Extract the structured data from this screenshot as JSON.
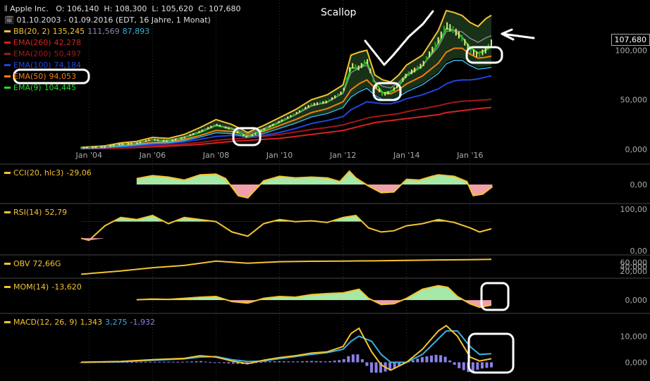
{
  "header": {
    "instrument": "Apple Inc.",
    "open": "O: 106,140",
    "high": "H: 108,300",
    "low": "L: 105,620",
    "close": "C: 107,680",
    "range": "01.10.2003 - 01.09.2016 (EDT, 16 Jahre, 1 Monat)",
    "last_price": "107,680"
  },
  "annotation_title": "Scallop",
  "legend": [
    {
      "label": "BB(20, 2)",
      "value": "135,245",
      "extra1": "111,569",
      "extra2": "87,893",
      "color": "#f4c430"
    },
    {
      "label": "EMA(260)",
      "value": "42,278",
      "color": "#d92020"
    },
    {
      "label": "EMA(200)",
      "value": "50,497",
      "color": "#a01818"
    },
    {
      "label": "EMA(100)",
      "value": "74,184",
      "color": "#2244dd"
    },
    {
      "label": "EMA(50)",
      "value": "94,053",
      "color": "#f08010"
    },
    {
      "label": "EMA(9)",
      "value": "104,445",
      "color": "#22dd22"
    }
  ],
  "panels": {
    "cci": {
      "label": "CCI(20, hlc3)",
      "value": "-29,06"
    },
    "rsi": {
      "label": "RSI(14)",
      "value": "52,79"
    },
    "obv": {
      "label": "OBV",
      "value": "72,66G"
    },
    "mom": {
      "label": "MOM(14)",
      "value": "-13,620"
    },
    "macd": {
      "label": "MACD(12, 26, 9)",
      "value": "1,343",
      "signal": "3,275",
      "hist": "-1,932"
    }
  },
  "chart_data": [
    {
      "type": "line",
      "title": "Apple Inc.",
      "x": [
        2003.75,
        2004.5,
        2005.0,
        2005.5,
        2006.0,
        2006.5,
        2007.0,
        2007.5,
        2008.0,
        2008.5,
        2009.0,
        2009.5,
        2010.0,
        2010.5,
        2011.0,
        2011.5,
        2012.0,
        2012.25,
        2012.5,
        2012.75,
        2013.0,
        2013.25,
        2013.5,
        2013.75,
        2014.0,
        2014.5,
        2015.0,
        2015.25,
        2015.5,
        2015.75,
        2016.0,
        2016.25,
        2016.5,
        2016.67
      ],
      "x_ticks": [
        "Jan '04",
        "Jan '06",
        "Jan '08",
        "Jan '10",
        "Jan '12",
        "Jan '14",
        "Jan '16"
      ],
      "x_tick_values": [
        2004,
        2006,
        2008,
        2010,
        2012,
        2014,
        2016
      ],
      "y_ticks": [
        "0,000",
        "50,000",
        "100,000"
      ],
      "y_tick_values": [
        0,
        50,
        100
      ],
      "ylim": [
        0,
        145
      ],
      "series": [
        {
          "name": "Close",
          "values": [
            1.5,
            2.5,
            5,
            6,
            10,
            8,
            12,
            18,
            25,
            20,
            12,
            20,
            28,
            36,
            45,
            48,
            58,
            85,
            82,
            90,
            65,
            55,
            58,
            65,
            75,
            85,
            110,
            125,
            120,
            112,
            100,
            95,
            100,
            107.68
          ]
        },
        {
          "name": "BB(20, 2)",
          "values": [
            2,
            3.5,
            6.5,
            8,
            12,
            11,
            15,
            22,
            30,
            25,
            17,
            24,
            32,
            40,
            50,
            55,
            65,
            95,
            98,
            100,
            75,
            70,
            68,
            75,
            85,
            95,
            120,
            140,
            138,
            135,
            128,
            124,
            132,
            135.2
          ]
        },
        {
          "name": "EMA(260)",
          "values": [
            0.5,
            0.7,
            1.2,
            1.8,
            2.5,
            3.2,
            4,
            5,
            6.5,
            8,
            9,
            10,
            11,
            13,
            15,
            17,
            19,
            21,
            23,
            25,
            27,
            28,
            29,
            30,
            31,
            33,
            35,
            37,
            38,
            39,
            40,
            41,
            41.8,
            42.3
          ]
        },
        {
          "name": "EMA(200)",
          "values": [
            0.8,
            1.1,
            1.7,
            2.5,
            3.5,
            4.5,
            5.5,
            7,
            9,
            10.5,
            11.5,
            13,
            15,
            17.5,
            20,
            22,
            24.5,
            27,
            29,
            31.5,
            33,
            34,
            35,
            36,
            38,
            41,
            44,
            46,
            47.5,
            48.5,
            49,
            49.5,
            50,
            50.5
          ]
        },
        {
          "name": "EMA(100)",
          "values": [
            1,
            1.5,
            2.5,
            3.5,
            5,
            6,
            7.5,
            10,
            13,
            14,
            13,
            14,
            17,
            21,
            26,
            29,
            33,
            40,
            44,
            48,
            47,
            46,
            46,
            48,
            51,
            55,
            61,
            66,
            69,
            70,
            70,
            71,
            73,
            74.2
          ]
        },
        {
          "name": "EMA(50)",
          "values": [
            1.2,
            2,
            3.5,
            5,
            7,
            7.5,
            10,
            14,
            19,
            18,
            14,
            18,
            24,
            30,
            37,
            41,
            48,
            60,
            66,
            70,
            62,
            57,
            56,
            60,
            66,
            74,
            87,
            98,
            102,
            102,
            96,
            92,
            93,
            94.05
          ]
        },
        {
          "name": "EMA(9)",
          "values": [
            1.5,
            2.4,
            4.8,
            6,
            9.5,
            8.2,
            12,
            17,
            24,
            20.5,
            13,
            19.5,
            27,
            35,
            44,
            47.5,
            57,
            82,
            82,
            88,
            68,
            57,
            58,
            64,
            74,
            84,
            107,
            122,
            120,
            113,
            103,
            97,
            100,
            104.4
          ]
        }
      ]
    },
    {
      "type": "area",
      "title": "CCI(20, hlc3)",
      "x": [
        2005.5,
        2006.0,
        2006.5,
        2007.0,
        2007.5,
        2008.0,
        2008.3,
        2008.7,
        2009.0,
        2009.5,
        2010.0,
        2010.5,
        2011.0,
        2011.5,
        2011.9,
        2012.2,
        2012.4,
        2012.8,
        2013.2,
        2013.6,
        2014.0,
        2014.4,
        2014.8,
        2015.0,
        2015.5,
        2015.9,
        2016.1,
        2016.4,
        2016.7
      ],
      "values": [
        80,
        120,
        100,
        60,
        130,
        140,
        80,
        -150,
        -180,
        50,
        110,
        90,
        100,
        90,
        40,
        180,
        90,
        -20,
        -110,
        -100,
        70,
        60,
        110,
        130,
        110,
        40,
        -150,
        -130,
        -29.06
      ],
      "y_ticks": [
        "0,00"
      ],
      "y_tick_values": [
        0
      ],
      "ylim": [
        -200,
        200
      ]
    },
    {
      "type": "area",
      "title": "RSI(14)",
      "x": [
        2003.75,
        2004.0,
        2004.5,
        2005.0,
        2005.5,
        2006.0,
        2006.5,
        2007.0,
        2007.5,
        2008.0,
        2008.5,
        2009.0,
        2009.5,
        2010.0,
        2010.5,
        2011.0,
        2011.5,
        2012.0,
        2012.4,
        2012.8,
        2013.2,
        2013.6,
        2014.0,
        2014.5,
        2015.0,
        2015.5,
        2016.0,
        2016.3,
        2016.67
      ],
      "values": [
        30,
        25,
        60,
        80,
        75,
        85,
        65,
        80,
        75,
        70,
        45,
        35,
        65,
        75,
        70,
        72,
        68,
        80,
        85,
        55,
        45,
        48,
        60,
        65,
        75,
        68,
        55,
        45,
        52.79
      ],
      "y_ticks": [
        "0,00",
        "100,00"
      ],
      "y_tick_values": [
        0,
        100
      ],
      "ylim": [
        0,
        100
      ]
    },
    {
      "type": "line",
      "title": "OBV",
      "x": [
        2003.75,
        2005.0,
        2006.0,
        2007.0,
        2008.0,
        2009.0,
        2010.0,
        2011.0,
        2012.0,
        2013.0,
        2014.0,
        2015.0,
        2016.0,
        2016.67
      ],
      "values": [
        5,
        20,
        35,
        45,
        65,
        55,
        62,
        64,
        65,
        66,
        68,
        70,
        71,
        72.66
      ],
      "y_ticks": [
        "20,000",
        "40,000",
        "60,000"
      ],
      "y_tick_values": [
        20,
        40,
        60
      ],
      "ylim": [
        0,
        80
      ]
    },
    {
      "type": "area",
      "title": "MOM(14)",
      "x": [
        2005.5,
        2006.0,
        2006.5,
        2007.0,
        2007.5,
        2008.0,
        2008.5,
        2009.0,
        2009.5,
        2010.0,
        2010.5,
        2011.0,
        2011.5,
        2012.0,
        2012.5,
        2012.8,
        2013.2,
        2013.6,
        2014.0,
        2014.5,
        2015.0,
        2015.3,
        2015.6,
        2016.0,
        2016.3,
        2016.67
      ],
      "values": [
        1,
        3,
        2,
        5,
        8,
        10,
        -4,
        -8,
        5,
        10,
        8,
        15,
        18,
        20,
        30,
        5,
        -12,
        -10,
        5,
        30,
        40,
        35,
        10,
        -10,
        -20,
        -13.62
      ],
      "y_ticks": [
        "0,000"
      ],
      "y_tick_values": [
        0
      ],
      "ylim": [
        -25,
        45
      ]
    },
    {
      "type": "line",
      "title": "MACD(12, 26, 9)",
      "x": [
        2003.75,
        2005.0,
        2006.0,
        2007.0,
        2007.5,
        2008.0,
        2008.5,
        2009.0,
        2009.5,
        2010.0,
        2010.5,
        2011.0,
        2011.5,
        2012.0,
        2012.25,
        2012.5,
        2012.9,
        2013.2,
        2013.5,
        2014.0,
        2014.5,
        2015.0,
        2015.25,
        2015.6,
        2016.0,
        2016.3,
        2016.67
      ],
      "series": [
        {
          "name": "MACD",
          "values": [
            0,
            0.3,
            1,
            1.5,
            2.5,
            2,
            0.5,
            -0.5,
            0.8,
            1.8,
            2.5,
            3.5,
            4,
            6,
            11,
            13,
            4,
            -1,
            -3,
            0,
            5,
            12,
            14,
            10,
            2,
            0.5,
            1.343
          ]
        },
        {
          "name": "Signal",
          "values": [
            0,
            0.2,
            0.8,
            1.3,
            2,
            2.2,
            1,
            0.3,
            0.5,
            1.4,
            2.2,
            3,
            3.7,
            5,
            8,
            10,
            8,
            3,
            0,
            0,
            3,
            9,
            12,
            12,
            6,
            3,
            3.275
          ]
        },
        {
          "name": "Histogram",
          "values": [
            0,
            0.1,
            0.2,
            0.2,
            0.5,
            -0.2,
            -0.5,
            -0.8,
            0.3,
            0.4,
            0.3,
            0.5,
            0.3,
            1,
            3,
            3,
            -4,
            -4,
            -3,
            0,
            2,
            3,
            2,
            -2,
            -4,
            -2.5,
            -1.932
          ]
        }
      ],
      "y_ticks": [
        "0,000",
        "10,000"
      ],
      "y_tick_values": [
        0,
        10
      ],
      "ylim": [
        -5,
        16
      ]
    }
  ]
}
